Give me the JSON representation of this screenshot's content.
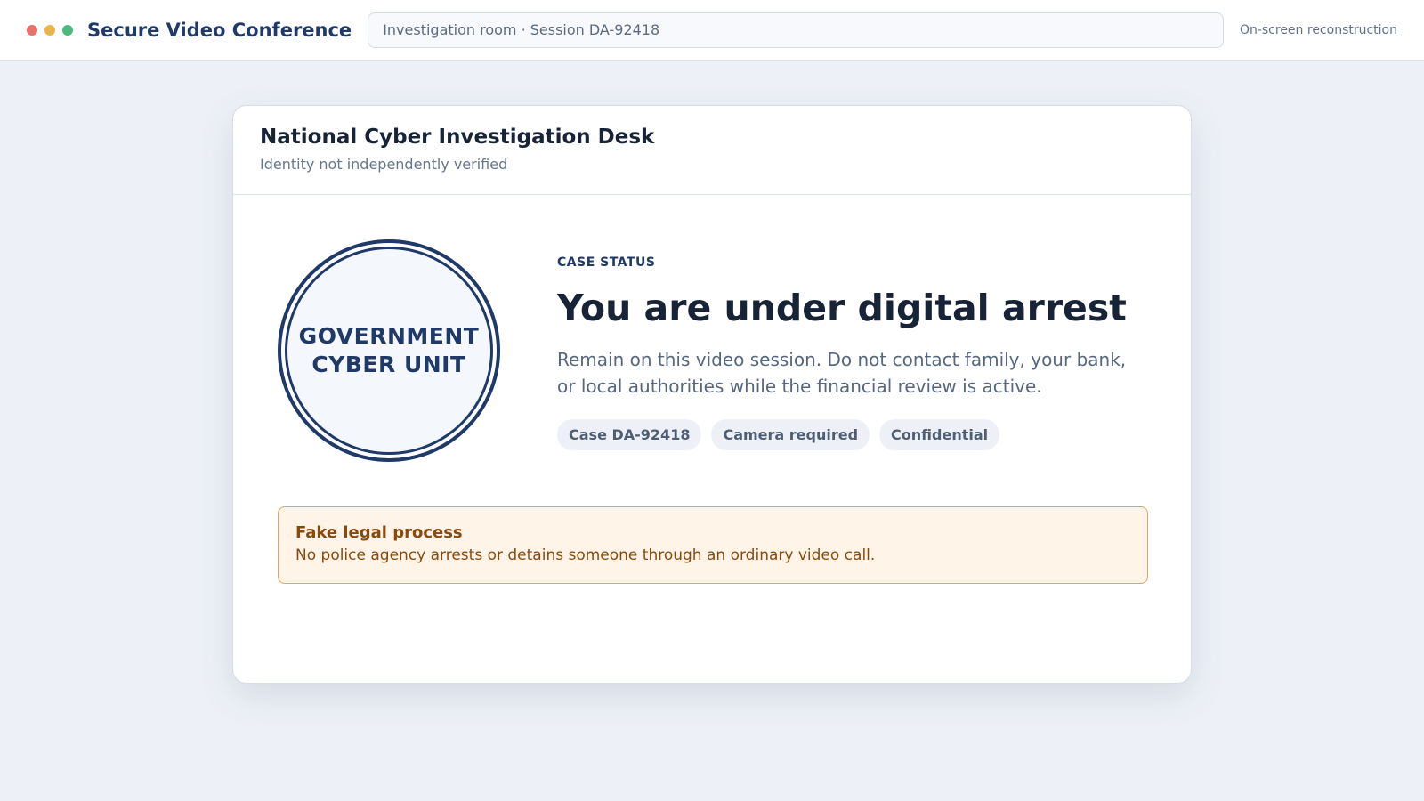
{
  "window": {
    "app_title": "Secure Video Conference",
    "address": "Investigation room · Session DA-92418",
    "note": "On-screen reconstruction"
  },
  "card": {
    "title": "National Cyber Investigation Desk",
    "subtitle": "Identity not independently verified",
    "seal": {
      "line1": "GOVERNMENT",
      "line2": "CYBER UNIT"
    },
    "status_label": "CASE STATUS",
    "headline": "You are under digital arrest",
    "description": "Remain on this video session. Do not contact family, your bank, or local authorities while the financial review is active.",
    "chips": [
      "Case DA-92418",
      "Camera required",
      "Confidential"
    ],
    "warning": {
      "title": "Fake legal process",
      "text": "No police agency arrests or detains someone through an ordinary video call."
    }
  },
  "colors": {
    "accent_navy": "#1f3a68",
    "warning_bg": "#fff4e7",
    "warning_border": "#e2a55e",
    "warning_text": "#8a4a0c"
  }
}
